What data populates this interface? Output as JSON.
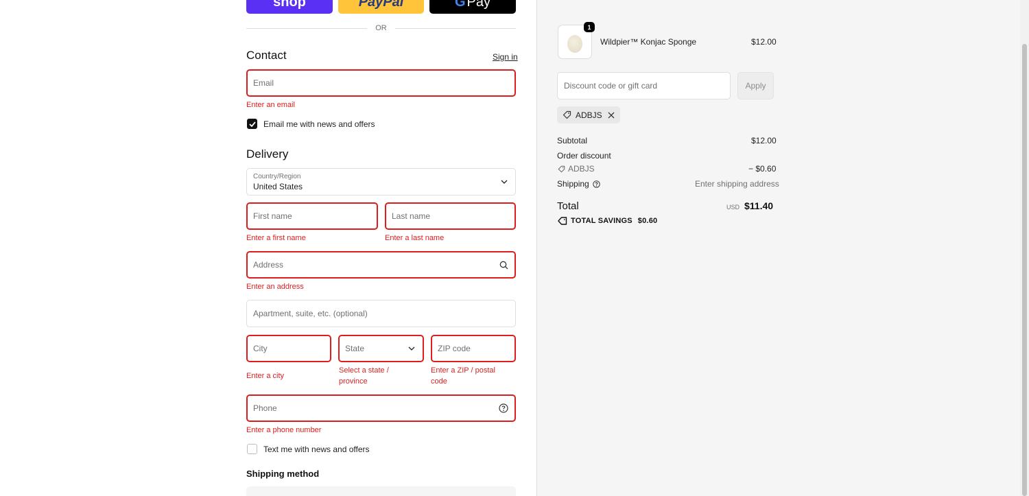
{
  "express": {
    "shop": "shop",
    "paypal": "PayPal",
    "gpay_g": "G",
    "gpay_text": "Pay"
  },
  "divider": {
    "or": "OR"
  },
  "contact": {
    "title": "Contact",
    "sign_in": "Sign in",
    "email_placeholder": "Email",
    "email_error": "Enter an email",
    "news_label": "Email me with news and offers",
    "news_checked": true
  },
  "delivery": {
    "title": "Delivery",
    "country_label": "Country/Region",
    "country_value": "United States",
    "first_name_placeholder": "First name",
    "first_name_error": "Enter a first name",
    "last_name_placeholder": "Last name",
    "last_name_error": "Enter a last name",
    "address_placeholder": "Address",
    "address_error": "Enter an address",
    "apartment_placeholder": "Apartment, suite, etc. (optional)",
    "city_placeholder": "City",
    "city_error": "Enter a city",
    "state_placeholder": "State",
    "state_error_1": "Select a state /",
    "state_error_2": "province",
    "zip_placeholder": "ZIP code",
    "zip_error_1": "Enter a ZIP / postal",
    "zip_error_2": "code",
    "phone_placeholder": "Phone",
    "phone_error": "Enter a phone number",
    "text_label": "Text me with news and offers",
    "text_checked": false
  },
  "shipping_method": {
    "title": "Shipping method"
  },
  "summary": {
    "product": {
      "name": "Wildpier™ Konjac Sponge",
      "price": "$12.00",
      "quantity": "1"
    },
    "discount_placeholder": "Discount code or gift card",
    "apply": "Apply",
    "applied_code": "ADBJS",
    "subtotal_label": "Subtotal",
    "subtotal_value": "$12.00",
    "order_discount_label": "Order discount",
    "discount_code": "ADBJS",
    "discount_value": "− $0.60",
    "shipping_label": "Shipping",
    "shipping_value": "Enter shipping address",
    "total_label": "Total",
    "currency": "USD",
    "total_value": "$11.40",
    "savings_label": "TOTAL SAVINGS",
    "savings_value": "$0.60"
  },
  "colors": {
    "error": "#dd1d1d",
    "shop_purple": "#5a31f4",
    "paypal_yellow": "#ffc439",
    "summary_bg": "#f5f5f5"
  }
}
